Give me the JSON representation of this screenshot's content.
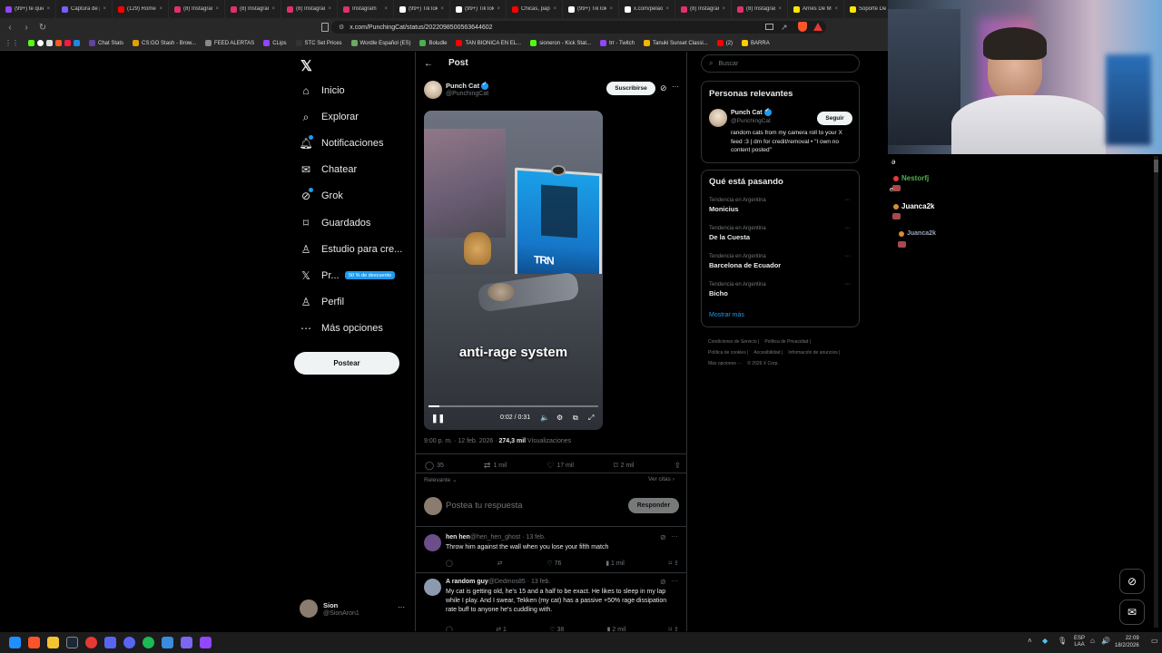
{
  "tabs": [
    {
      "label": "(99+) te quie",
      "color": "#9146ff"
    },
    {
      "label": "Captura de p",
      "color": "#7a5cff"
    },
    {
      "label": "(129) Romeo",
      "color": "#ff0000"
    },
    {
      "label": "(8) Instagram",
      "color": "#e1306c"
    },
    {
      "label": "(8) Instagram",
      "color": "#e1306c"
    },
    {
      "label": "(8) Instagram",
      "color": "#e1306c"
    },
    {
      "label": "Instagram",
      "color": "#e1306c"
    },
    {
      "label": "(99+) TikTok",
      "color": "#ffffff"
    },
    {
      "label": "(99+) TikTok",
      "color": "#ffffff"
    },
    {
      "label": "Chicas, papel",
      "color": "#ff0000"
    },
    {
      "label": "(99+) TikTok",
      "color": "#ffffff"
    },
    {
      "label": "x.com/pelaos",
      "color": "#ffffff"
    },
    {
      "label": "(8) Instagram",
      "color": "#e1306c"
    },
    {
      "label": "(8) Instagram",
      "color": "#e1306c"
    },
    {
      "label": "Arnés De Mo",
      "color": "#ffe600"
    },
    {
      "label": "Soporte De C",
      "color": "#ffe600"
    },
    {
      "label": "(8) Instagra",
      "color": "#e1306c"
    }
  ],
  "url": "x.com/PunchingCat/status/2022098500563644602",
  "bookmarks": [
    {
      "label": "Chat Stats",
      "color": "#6441a5"
    },
    {
      "label": "CS:GO Stash - Brow...",
      "color": "#e0a000"
    },
    {
      "label": "FEED ALERTAS",
      "color": "#888888"
    },
    {
      "label": "CLips",
      "color": "#9146ff"
    },
    {
      "label": "STC Set Prices",
      "color": "#333333"
    },
    {
      "label": "Wordle Español (ES)",
      "color": "#6aaa64"
    },
    {
      "label": "Boludle",
      "color": "#4caf50"
    },
    {
      "label": "TAN BIONICA EN EL...",
      "color": "#ff0000"
    },
    {
      "label": "sioneron - Kick Stat...",
      "color": "#53fc18"
    },
    {
      "label": "trr - Twitch",
      "color": "#9146ff"
    },
    {
      "label": "Tanuki Sunset Classi...",
      "color": "#f4b400"
    },
    {
      "label": "(2)",
      "color": "#ff0000"
    },
    {
      "label": "BARRA",
      "color": "#ffcc00"
    }
  ],
  "nav": {
    "items": [
      {
        "label": "Inicio",
        "icon": "home-icon"
      },
      {
        "label": "Explorar",
        "icon": "search-icon"
      },
      {
        "label": "Notificaciones",
        "icon": "bell-icon"
      },
      {
        "label": "Chatear",
        "icon": "mail-icon"
      },
      {
        "label": "Grok",
        "icon": "grok-icon"
      },
      {
        "label": "Guardados",
        "icon": "bookmark-icon"
      },
      {
        "label": "Estudio para cre...",
        "icon": "studio-icon"
      },
      {
        "label": "Pr...",
        "icon": "x-logo-icon"
      },
      {
        "label": "Perfil",
        "icon": "person-icon"
      },
      {
        "label": "Más opciones",
        "icon": "more-icon"
      }
    ],
    "premium_badge": "50 % de descuento",
    "post_button": "Postear",
    "user": {
      "name": "Sion",
      "handle": "@SionAron1"
    }
  },
  "post": {
    "header": "Post",
    "author_name": "Punch Cat",
    "author_handle": "@PunchingCat",
    "subscribe": "Suscribirse",
    "video_caption": "anti-rage system",
    "video_time": "0:02 / 0:31",
    "video_progress": 0.065,
    "meta_time": "9:00 p. m. · 12 feb. 2026 ·",
    "meta_views_count": "274,3 mil",
    "meta_views_label": "Visualizaciones",
    "stats": {
      "replies": "35",
      "reposts": "1 mil",
      "likes": "17 mil",
      "bookmarks": "2 mil"
    },
    "sort_label": "Relevante",
    "quotes_label": "Ver citas",
    "reply_placeholder": "Postea tu respuesta",
    "reply_button": "Responder"
  },
  "replies": [
    {
      "name": "hen hen",
      "handle": "@hen_hen_ghost · 13 feb.",
      "text": "Throw him against the wall when you lose your fifth match",
      "likes": "76",
      "views": "1 mil",
      "avatar_color": "#6b4e8a"
    },
    {
      "name": "A random guy",
      "handle": "@Dedmos85 · 13 feb.",
      "text": "My cat is getting old, he's 15 and a half to be exact. He likes to sleep in my lap while I play. And I swear, Tekken (my cat) has a passive +50% rage dissipation rate buff to anyone he's cuddling with.",
      "reposts": "1",
      "likes": "38",
      "views": "2 mil",
      "avatar_color": "#8c9ab0"
    }
  ],
  "right": {
    "search_placeholder": "Buscar",
    "relevant_title": "Personas relevantes",
    "relevant": {
      "name": "Punch Cat",
      "handle": "@PunchingCat",
      "follow": "Seguir",
      "bio": "random cats from my camera roll to your X feed :3 | dm for credit/removal • \"I own no content posted\""
    },
    "trending_title": "Qué está pasando",
    "trends": [
      {
        "category": "Tendencia en Argentina",
        "name": "Monicius"
      },
      {
        "category": "Tendencia en Argentina",
        "name": "De la Cuesta"
      },
      {
        "category": "Tendencia en Argentina",
        "name": "Barcelona de Ecuador"
      },
      {
        "category": "Tendencia en Argentina",
        "name": "Bicho"
      }
    ],
    "show_more": "Mostrar más",
    "footer": [
      "Condiciones de Servicio |",
      "Política de Privacidad |",
      "Política de cookies |",
      "Accesibilidad |",
      "Información de anuncios |",
      "Más opciones ···",
      "© 2026 X Corp."
    ]
  },
  "chat": [
    {
      "user": "Nestorfj",
      "color": "#4caf50"
    },
    {
      "user": "Juanca2k",
      "color": "#ffffff"
    },
    {
      "user": "Juanca2k",
      "color": "#9aa4b8"
    }
  ],
  "chat_marks": {
    "a": "ə",
    "e": "e"
  },
  "taskbar": {
    "lang1": "ESP",
    "lang2": "LAA",
    "time": "22:09",
    "date": "18/2/2026"
  }
}
